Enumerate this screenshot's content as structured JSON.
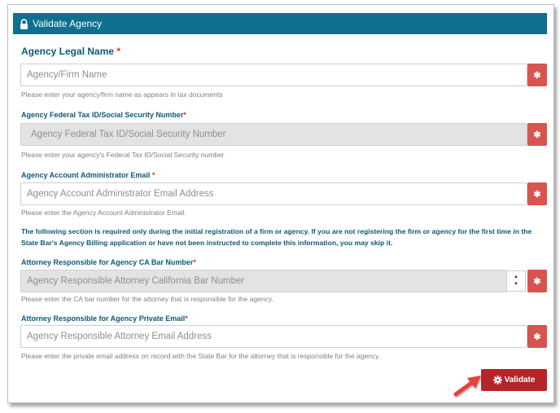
{
  "panel": {
    "title": "Validate Agency",
    "lock_icon": "lock-icon"
  },
  "fields": {
    "legal_name": {
      "label": "Agency Legal Name",
      "required_mark": "*",
      "placeholder": "Agency/Firm Name",
      "help": "Please enter your agency/firm name as appears in tax documents"
    },
    "tax_id": {
      "label": "Agency Federal Tax ID/Social Security Number",
      "required_mark": "*",
      "placeholder": "Agency Federal Tax ID/Social Security Number",
      "help": "Please enter your agency's Federal Tax ID/Social Security number"
    },
    "admin_email": {
      "label": "Agency Account Administrator Email",
      "required_mark": "*",
      "placeholder": "Agency Account Administrator Email Address",
      "help": "Please enter the Agency Account Administrator Email."
    },
    "notice": "The following section is required only during the initial registration of a firm or agency. If you are not registering the firm or agency for the first time in the State Bar's Agency Billing application or have not been instructed to complete this information, you may skip it.",
    "bar_number": {
      "label": "Attorney Responsible for Agency CA Bar Number",
      "required_mark": "*",
      "placeholder": "Agency Responsible Attorney California Bar Number",
      "help": "Please enter the CA bar number for the attorney that is responsible for the agency."
    },
    "private_email": {
      "label": "Attorney Responsible for Agency Private Email",
      "required_mark": "*",
      "placeholder": "Agency Responsible Attorney Email Address",
      "help": "Please enter the private email address on record with the State Bar for the attorney that is responsible for the agency."
    }
  },
  "required_button_glyph": "✱",
  "spinner": {
    "up": "▲",
    "down": "▼"
  },
  "validate_button": {
    "label": "Validate",
    "icon": "gear-icon"
  },
  "colors": {
    "header_bg": "#0e6f8f",
    "label": "#0b5a78",
    "required": "#d9332b",
    "required_button": "#d9534f",
    "validate_button": "#b52428",
    "arrow": "#e8413a"
  }
}
